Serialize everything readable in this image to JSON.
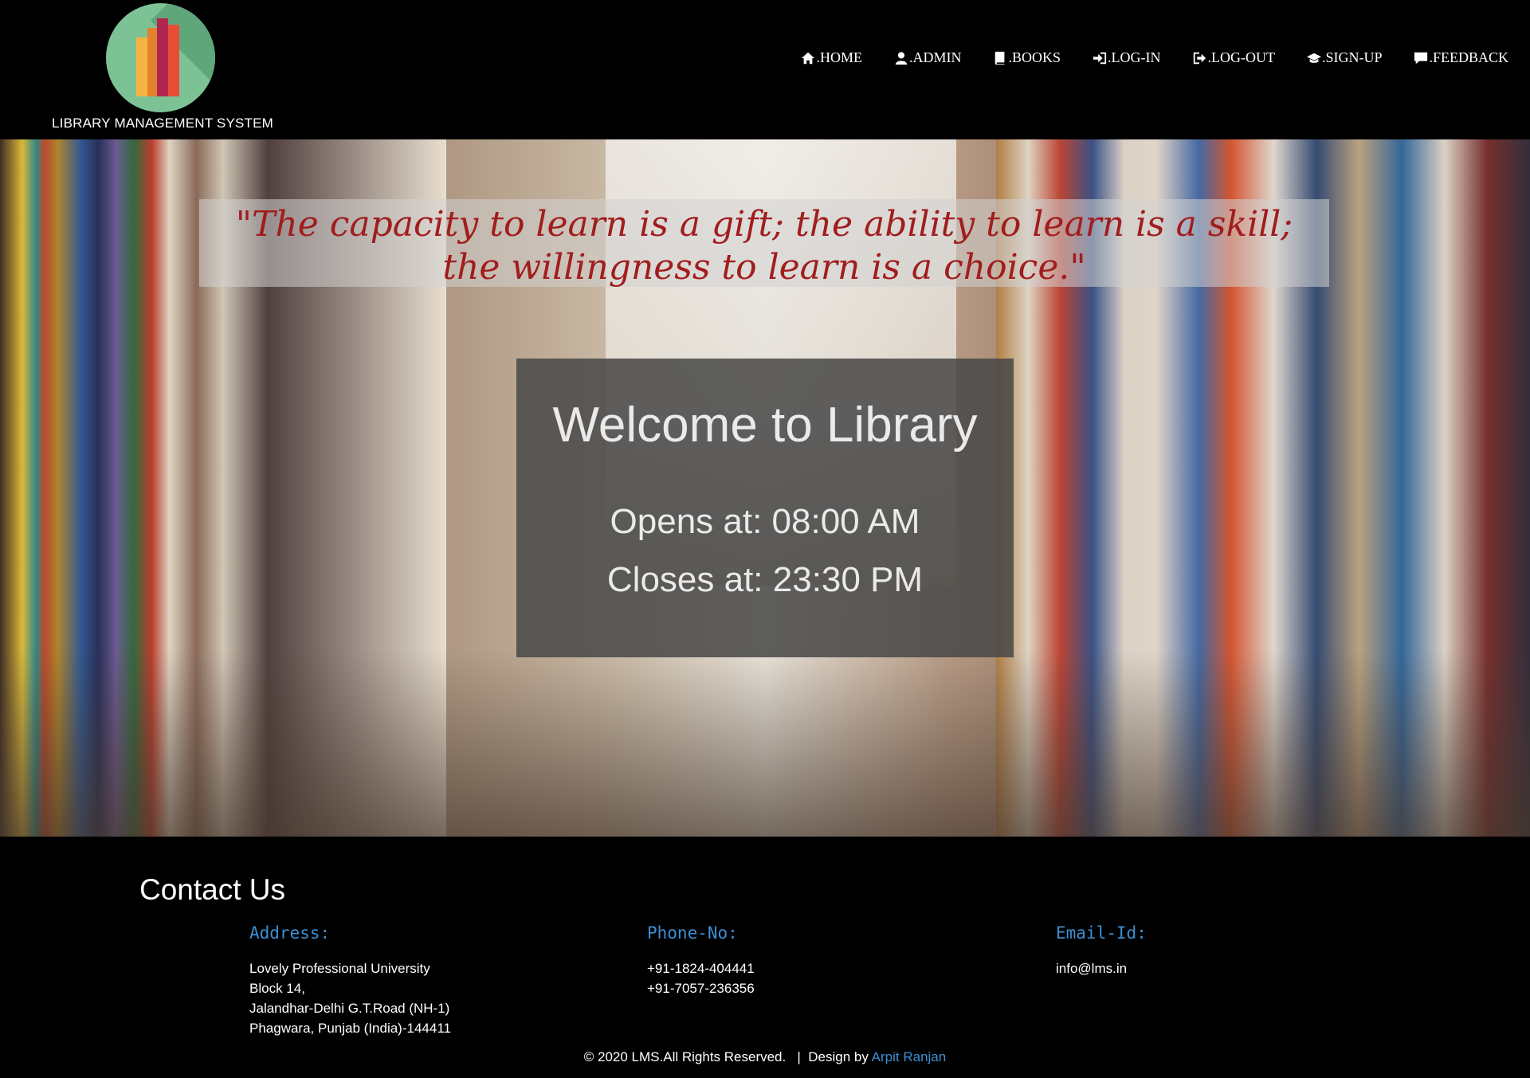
{
  "brand": {
    "title": "LIBRARY MANAGEMENT SYSTEM",
    "logo_colors": [
      "#f4b343",
      "#e3822b",
      "#b0264f",
      "#e94d36",
      "#7cc295"
    ]
  },
  "nav": [
    {
      "label": ".HOME",
      "icon": "home-icon"
    },
    {
      "label": ".ADMIN",
      "icon": "user-icon"
    },
    {
      "label": ".BOOKS",
      "icon": "book-icon"
    },
    {
      "label": ".LOG-IN",
      "icon": "log-in-icon"
    },
    {
      "label": ".LOG-OUT",
      "icon": "log-out-icon"
    },
    {
      "label": ".SIGN-UP",
      "icon": "graduation-cap-icon"
    },
    {
      "label": ".FEEDBACK",
      "icon": "comment-icon"
    }
  ],
  "hero": {
    "quote_line1": "\"The capacity to learn is a gift; the ability to learn is a skill;",
    "quote_line2": "the willingness to learn is a choice.\"",
    "welcome": "Welcome to Library",
    "opens": "Opens at: 08:00 AM",
    "closes": "Closes at: 23:30 PM"
  },
  "contact": {
    "title": "Contact Us",
    "address_label": "Address:",
    "address_lines": [
      "Lovely Professional University",
      "Block 14,",
      "Jalandhar-Delhi G.T.Road (NH-1)",
      "Phagwara, Punjab (India)-144411"
    ],
    "phone_label": "Phone-No:",
    "phones": [
      "+91-1824-404441",
      "+91-7057-236356"
    ],
    "email_label": "Email-Id:",
    "email": "info@lms.in"
  },
  "footer": {
    "copyright": "© 2020 LMS.All Rights Reserved.   |  Design by ",
    "designer": "Arpit Ranjan"
  },
  "colors": {
    "accent": "#3d8fd4",
    "quote": "#a11d1d"
  }
}
